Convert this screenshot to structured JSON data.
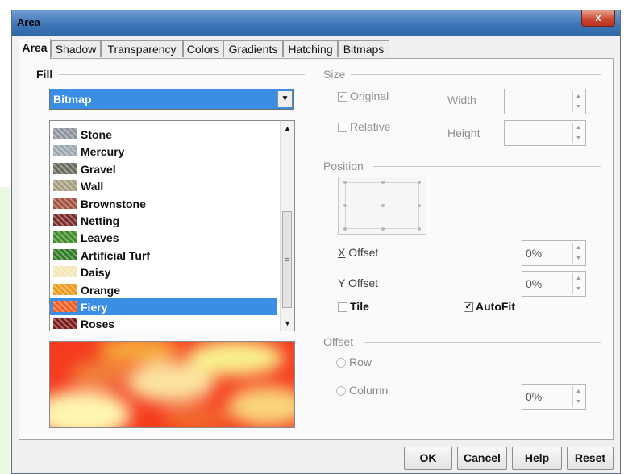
{
  "window": {
    "title": "Area",
    "close_glyph": "x"
  },
  "tabs": [
    {
      "label": "Area",
      "active": true
    },
    {
      "label": "Shadow"
    },
    {
      "label": "Transparency"
    },
    {
      "label": "Colors"
    },
    {
      "label": "Gradients"
    },
    {
      "label": "Hatching"
    },
    {
      "label": "Bitmaps"
    }
  ],
  "fill": {
    "group_label": "Fill",
    "type_value": "Bitmap",
    "bitmaps": [
      {
        "label": "Stone",
        "color": "#8e949e"
      },
      {
        "label": "Mercury",
        "color": "#9aa7ae"
      },
      {
        "label": "Gravel",
        "color": "#6c6a5e"
      },
      {
        "label": "Wall",
        "color": "#a89d7e"
      },
      {
        "label": "Brownstone",
        "color": "#a5503c"
      },
      {
        "label": "Netting",
        "color": "#7a2b2b"
      },
      {
        "label": "Leaves",
        "color": "#3f8d2a"
      },
      {
        "label": "Artificial Turf",
        "color": "#2f7a23"
      },
      {
        "label": "Daisy",
        "color": "#f3e7b5"
      },
      {
        "label": "Orange",
        "color": "#f09a1c"
      },
      {
        "label": "Fiery",
        "color": "#f25c22",
        "selected": true
      },
      {
        "label": "Roses",
        "color": "#7d1b1b"
      }
    ]
  },
  "size": {
    "group_label": "Size",
    "original_label": "Original",
    "original_checked": true,
    "relative_label": "Relative",
    "relative_checked": false,
    "width_label": "Width",
    "height_label": "Height",
    "width_value": "",
    "height_value": ""
  },
  "position": {
    "group_label": "Position",
    "x_offset_label": "X Offset",
    "x_offset_value": "0%",
    "y_offset_label": "Y Offset",
    "y_offset_value": "0%",
    "tile_label": "Tile",
    "tile_checked": false,
    "autofit_label": "AutoFit",
    "autofit_checked": true
  },
  "offset": {
    "group_label": "Offset",
    "row_label": "Row",
    "column_label": "Column",
    "value": "0%"
  },
  "buttons": {
    "ok": "OK",
    "cancel": "Cancel",
    "help": "Help",
    "reset": "Reset"
  },
  "glyphs": {
    "check": "✓",
    "up": "▲",
    "down": "▼"
  },
  "icons": {
    "dropdown": "chevron-down-icon",
    "scroll_up": "scroll-up-icon",
    "scroll_down": "scroll-down-icon"
  },
  "colors": {
    "selection": "#3b8ee6",
    "title_bar": "#3d76b8",
    "close": "#c9442b"
  }
}
